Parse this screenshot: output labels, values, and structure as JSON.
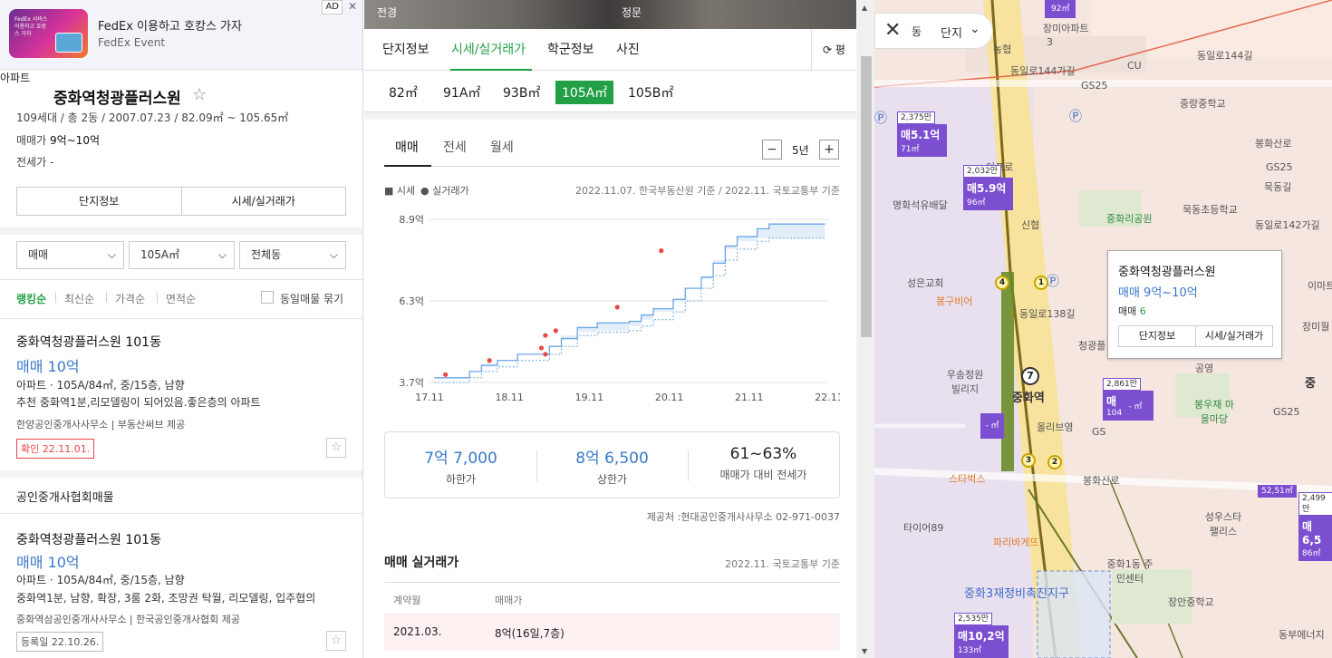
{
  "ad": {
    "thumb_text": "FedEx 서비스 이용하고 호캉스 가자",
    "title": "FedEx 이용하고 호캉스 가자",
    "subtitle": "FedEx Event",
    "tag": "AD",
    "close": "✕"
  },
  "complex": {
    "type": "아파트",
    "name": "중화역청광플러스원",
    "star": "☆",
    "summary": "109세대 / 총 2동 / 2007.07.23 / 82.09㎡ ~ 105.65㎡",
    "sale_label": "매매가",
    "sale_value": "9억~10억",
    "jeonse_label": "전세가",
    "jeonse_value": "-",
    "btn_info": "단지정보",
    "btn_price": "시세/실거래가"
  },
  "filters": {
    "deal": "매매",
    "area": "105A㎡",
    "dong": "전체동",
    "chevron": "⌄"
  },
  "sort": {
    "items": [
      "랭킹순",
      "최신순",
      "가격순",
      "면적순"
    ],
    "checkbox_label": "동일매물 묶기"
  },
  "listings": [
    {
      "title": "중화역청광플러스원 101동",
      "price": "매매 10억",
      "spec": "아파트 · 105A/84㎡, 중/15층, 남향",
      "desc": "추천 중화역1분,리모델링이 되어있음.좋은층의 아파트",
      "agent": "한양공인중개사사무소 | 부동산써브 제공",
      "badge": "확인 22.11.01."
    },
    {
      "title": "중화역청광플러스원 101동",
      "price": "매매 10억",
      "spec": "아파트 · 105A/84㎡, 중/15층, 남향",
      "desc": "중화역1분, 남향, 확장, 3룸 2화, 조망권 탁월, 리모델링, 입주협의",
      "agent": "중화역삼공인중개사사무소 | 한국공인중개사협회 제공",
      "badge": "등록일 22.10.26."
    }
  ],
  "group_title": "공인중개사협회매물",
  "photo_labels": [
    "전경",
    "정문"
  ],
  "tabs": {
    "items": [
      "단지정보",
      "시세/실거래가",
      "학군정보",
      "사진"
    ],
    "pyung": "⟳ 평"
  },
  "sizes": [
    "82㎡",
    "91A㎡",
    "93B㎡",
    "105A㎡",
    "105B㎡"
  ],
  "chart_tabs": [
    "매매",
    "전세",
    "월세"
  ],
  "period": {
    "minus": "−",
    "value": "5년",
    "plus": "+"
  },
  "legend": {
    "market": "■ 시세",
    "actual": "● 실거래가"
  },
  "chart_source": "2022.11.07. 한국부동산원 기준 / 2022.11. 국토교통부 기준",
  "colors": {
    "accent": "#22a045",
    "price_blue": "#3a78c9",
    "marker_purple": "#7c4fd0",
    "dot_red": "#e84848"
  },
  "chart_data": {
    "type": "line",
    "x_ticks": [
      "17.11",
      "18.11",
      "19.11",
      "20.11",
      "21.11",
      "22.11"
    ],
    "y_ticks": [
      "3.7억",
      "6.3억",
      "8.9억"
    ],
    "ylim": [
      3.7,
      8.9
    ],
    "xlim": [
      2017.9,
      2022.9
    ],
    "series": [
      {
        "name": "시세",
        "band": [
          [
            2017.96,
            3.7,
            3.85
          ],
          [
            2018.4,
            3.85,
            4.05
          ],
          [
            2018.55,
            4.05,
            4.25
          ],
          [
            2018.75,
            4.2,
            4.4
          ],
          [
            2019.0,
            4.4,
            4.6
          ],
          [
            2019.4,
            4.6,
            4.85
          ],
          [
            2019.55,
            4.85,
            5.1
          ],
          [
            2019.75,
            5.2,
            5.45
          ],
          [
            2020.0,
            5.3,
            5.6
          ],
          [
            2020.4,
            5.35,
            5.65
          ],
          [
            2020.55,
            5.5,
            5.85
          ],
          [
            2020.7,
            5.7,
            6.05
          ],
          [
            2020.95,
            5.95,
            6.35
          ],
          [
            2021.1,
            6.3,
            6.7
          ],
          [
            2021.3,
            6.7,
            7.05
          ],
          [
            2021.45,
            7.1,
            7.5
          ],
          [
            2021.6,
            7.6,
            8.05
          ],
          [
            2021.75,
            7.95,
            8.35
          ],
          [
            2022.0,
            8.2,
            8.6
          ],
          [
            2022.15,
            8.3,
            8.75
          ],
          [
            2022.85,
            8.3,
            8.75
          ]
        ]
      },
      {
        "name": "실거래가",
        "points": [
          [
            2018.1,
            3.95
          ],
          [
            2018.65,
            4.4
          ],
          [
            2019.3,
            4.8
          ],
          [
            2019.35,
            5.2
          ],
          [
            2019.48,
            5.35
          ],
          [
            2019.35,
            4.6
          ],
          [
            2020.25,
            6.1
          ],
          [
            2020.8,
            7.9
          ]
        ]
      }
    ]
  },
  "stats": [
    {
      "value": "7억 7,000",
      "label": "하한가"
    },
    {
      "value": "8억 6,500",
      "label": "상한가"
    },
    {
      "value": "61~63%",
      "label": "매매가 대비 전세가"
    }
  ],
  "contact": "제공처 :현대공인중개사사무소 02-971-0037",
  "trades": {
    "title": "매매 실거래가",
    "source": "2022.11. 국토교통부 기준",
    "headers": [
      "계약월",
      "매매가"
    ],
    "rows": [
      {
        "month": "2021.03.",
        "price": "8억(16일,7층)"
      }
    ]
  },
  "map": {
    "close_label": "동",
    "filter_label": "단지",
    "labels": [
      "농협",
      "동일로144가길",
      "CU",
      "동일로144길",
      "GS25",
      "GS25",
      "중랑중학교",
      "봉화산로",
      "어프로",
      "명화석유배달",
      "신협",
      "중화리공원",
      "묵동초등학교",
      "묵동길",
      "동일로142가길",
      "성은교회",
      "봉구비어",
      "동일로138길",
      "청광플",
      "우송정원 빌리지",
      "중화역",
      "올리브영",
      "공영",
      "봉우재 마을마당",
      "GS25",
      "스타벅스",
      "봉화산로",
      "타이어89",
      "파리바게뜨",
      "중화1동 주민센터",
      "성우스타 팰리스",
      "장안중학교",
      "중화3재정비촉진지구",
      "동부에너지",
      "이마트",
      "장미월",
      "중",
      "장미아파트",
      "3",
      "GS"
    ],
    "markers": [
      {
        "top": "2,375만",
        "price": "매5.1억",
        "area": "71㎡"
      },
      {
        "top": "2,032만",
        "price": "매5.9억",
        "area": "96㎡"
      },
      {
        "top": "2,861만",
        "price": "매",
        "area": "104"
      },
      {
        "top": "2,535만",
        "price": "매10,2억",
        "area": "133㎡"
      },
      {
        "top": "2,499만",
        "price": "매6,5",
        "area": "86㎡"
      },
      {
        "top": "52,51㎡",
        "price": "",
        "area": ""
      },
      {
        "top": "92㎡",
        "price": "",
        "area": ""
      }
    ],
    "pins": [
      "- ㎡",
      "- ㎡"
    ],
    "stations": [
      "4",
      "1",
      "7",
      "3",
      "2"
    ],
    "popup": {
      "name": "중화역청광플러스원",
      "price": "매매 9억~10억",
      "count_label": "매매",
      "count": "6",
      "btn_info": "단지정보",
      "btn_price": "시세/실거래가"
    }
  }
}
